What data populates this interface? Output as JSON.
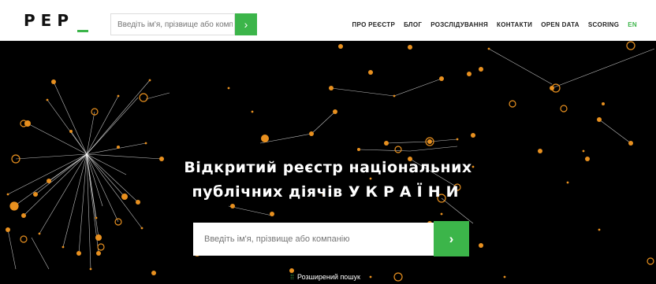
{
  "header": {
    "logo": "PEP",
    "search_placeholder": "Введіть ім'я, прізвище або компанію",
    "search_button_icon": "chevron-right-icon",
    "nav": {
      "about": "ПРО РЕЄСТР",
      "blog": "БЛОГ",
      "investigations": "РОЗСЛІДУВАННЯ",
      "contacts": "КОНТАКТИ",
      "open_data": "OPEN DATA",
      "scoring": "SCORING",
      "lang": "EN"
    }
  },
  "hero": {
    "line1": "Відкритий реєстр національних",
    "line2_prefix": "публічних діячів",
    "line2_country": "УКРАЇНИ"
  },
  "search": {
    "placeholder": "Введіть ім'я, прізвище або компанію",
    "button_icon": "chevron-right-icon"
  },
  "advanced_search": "Розширений пошук",
  "colors": {
    "accent": "#3cb54a",
    "node": "#e8901f",
    "background": "#000000"
  }
}
